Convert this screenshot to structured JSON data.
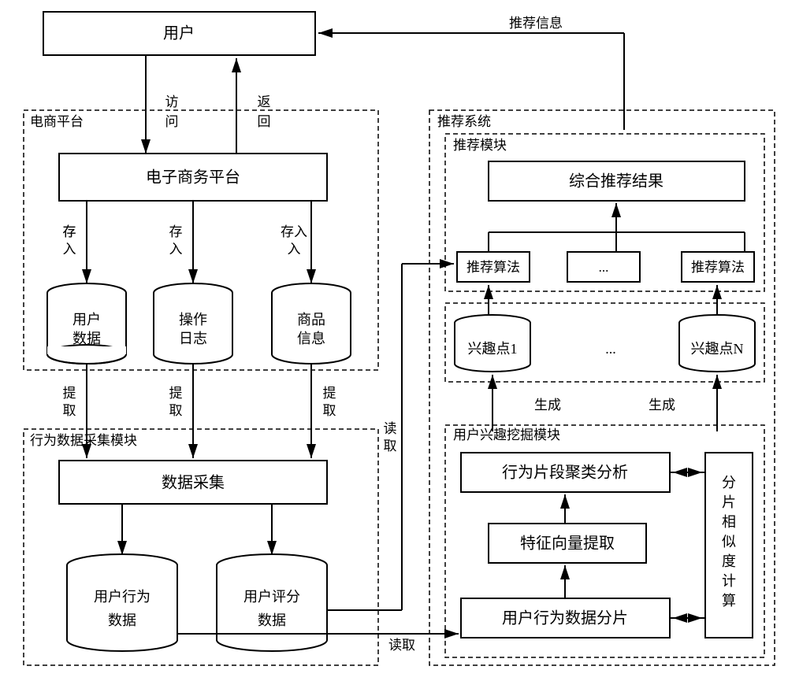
{
  "user": "用户",
  "edge_recommend_info": "推荐信息",
  "edge_access": "访问",
  "edge_return": "返回",
  "ecom_section_label": "电商平台",
  "ecom_platform_box": "电子商务平台",
  "edge_store": "存入",
  "db_user_data_l1": "用户",
  "db_user_data_l2": "数据",
  "db_op_log_l1": "操作",
  "db_op_log_l2": "日志",
  "db_product_l1": "商品",
  "db_product_l2": "信息",
  "edge_extract": "提取",
  "behavior_section_label": "行为数据采集模块",
  "data_collection_box": "数据采集",
  "db_user_behavior_l1": "用户行为",
  "db_user_behavior_l2": "数据",
  "db_user_rating_l1": "用户评分",
  "db_user_rating_l2": "数据",
  "rec_system_label": "推荐系统",
  "rec_module_label": "推荐模块",
  "combined_result_box": "综合推荐结果",
  "rec_algo": "推荐算法",
  "ellipsis": "...",
  "db_poi1": "兴趣点1",
  "db_poiN": "兴趣点N",
  "edge_generate": "生成",
  "interest_mining_label": "用户兴趣挖掘模块",
  "cluster_analysis_box": "行为片段聚类分析",
  "feature_extract_box": "特征向量提取",
  "behavior_slice_box": "用户行为数据分片",
  "similarity_calc": "分片相似度计算",
  "edge_read": "读取"
}
